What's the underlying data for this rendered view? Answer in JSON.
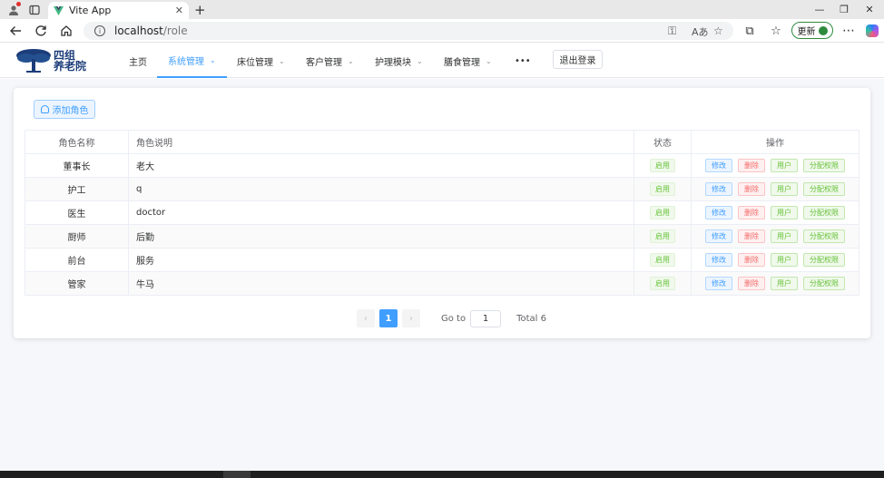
{
  "browser": {
    "tab_title": "Vite App",
    "tab_close": "✕",
    "new_tab": "+",
    "url_host": "localhost",
    "url_path": "/role",
    "update_label": "更新",
    "window_minimize": "—",
    "window_maximize": "❐",
    "window_close": "✕"
  },
  "app": {
    "logo_line1": "四组",
    "logo_line2": "养老院",
    "menu": [
      {
        "label": "主页",
        "has_arrow": false
      },
      {
        "label": "系统管理",
        "has_arrow": true,
        "active": true
      },
      {
        "label": "床位管理",
        "has_arrow": true
      },
      {
        "label": "客户管理",
        "has_arrow": true
      },
      {
        "label": "护理模块",
        "has_arrow": true
      },
      {
        "label": "膳食管理",
        "has_arrow": true
      },
      {
        "label": "•••",
        "has_arrow": false
      }
    ],
    "logout_label": "退出登录"
  },
  "main": {
    "add_role_label": "添加角色",
    "columns": [
      "角色名称",
      "角色说明",
      "状态",
      "操作"
    ],
    "rows": [
      {
        "name": "董事长",
        "desc": "老大",
        "status": "启用"
      },
      {
        "name": "护工",
        "desc": "q",
        "status": "启用"
      },
      {
        "name": "医生",
        "desc": "doctor",
        "status": "启用"
      },
      {
        "name": "厨师",
        "desc": "后勤",
        "status": "启用"
      },
      {
        "name": "前台",
        "desc": "服务",
        "status": "启用"
      },
      {
        "name": "管家",
        "desc": "牛马",
        "status": "启用"
      }
    ],
    "actions": {
      "edit": "修改",
      "delete": "删除",
      "users": "用户",
      "assign": "分配权限"
    },
    "pagination": {
      "prev": "‹",
      "next": "›",
      "current_page": "1",
      "goto_label": "Go to",
      "goto_value": "1",
      "total_label": "Total 6"
    }
  },
  "colors": {
    "primary": "#409eff",
    "success": "#67c23a",
    "danger": "#f56c6c",
    "logo": "#1c3d7a"
  }
}
